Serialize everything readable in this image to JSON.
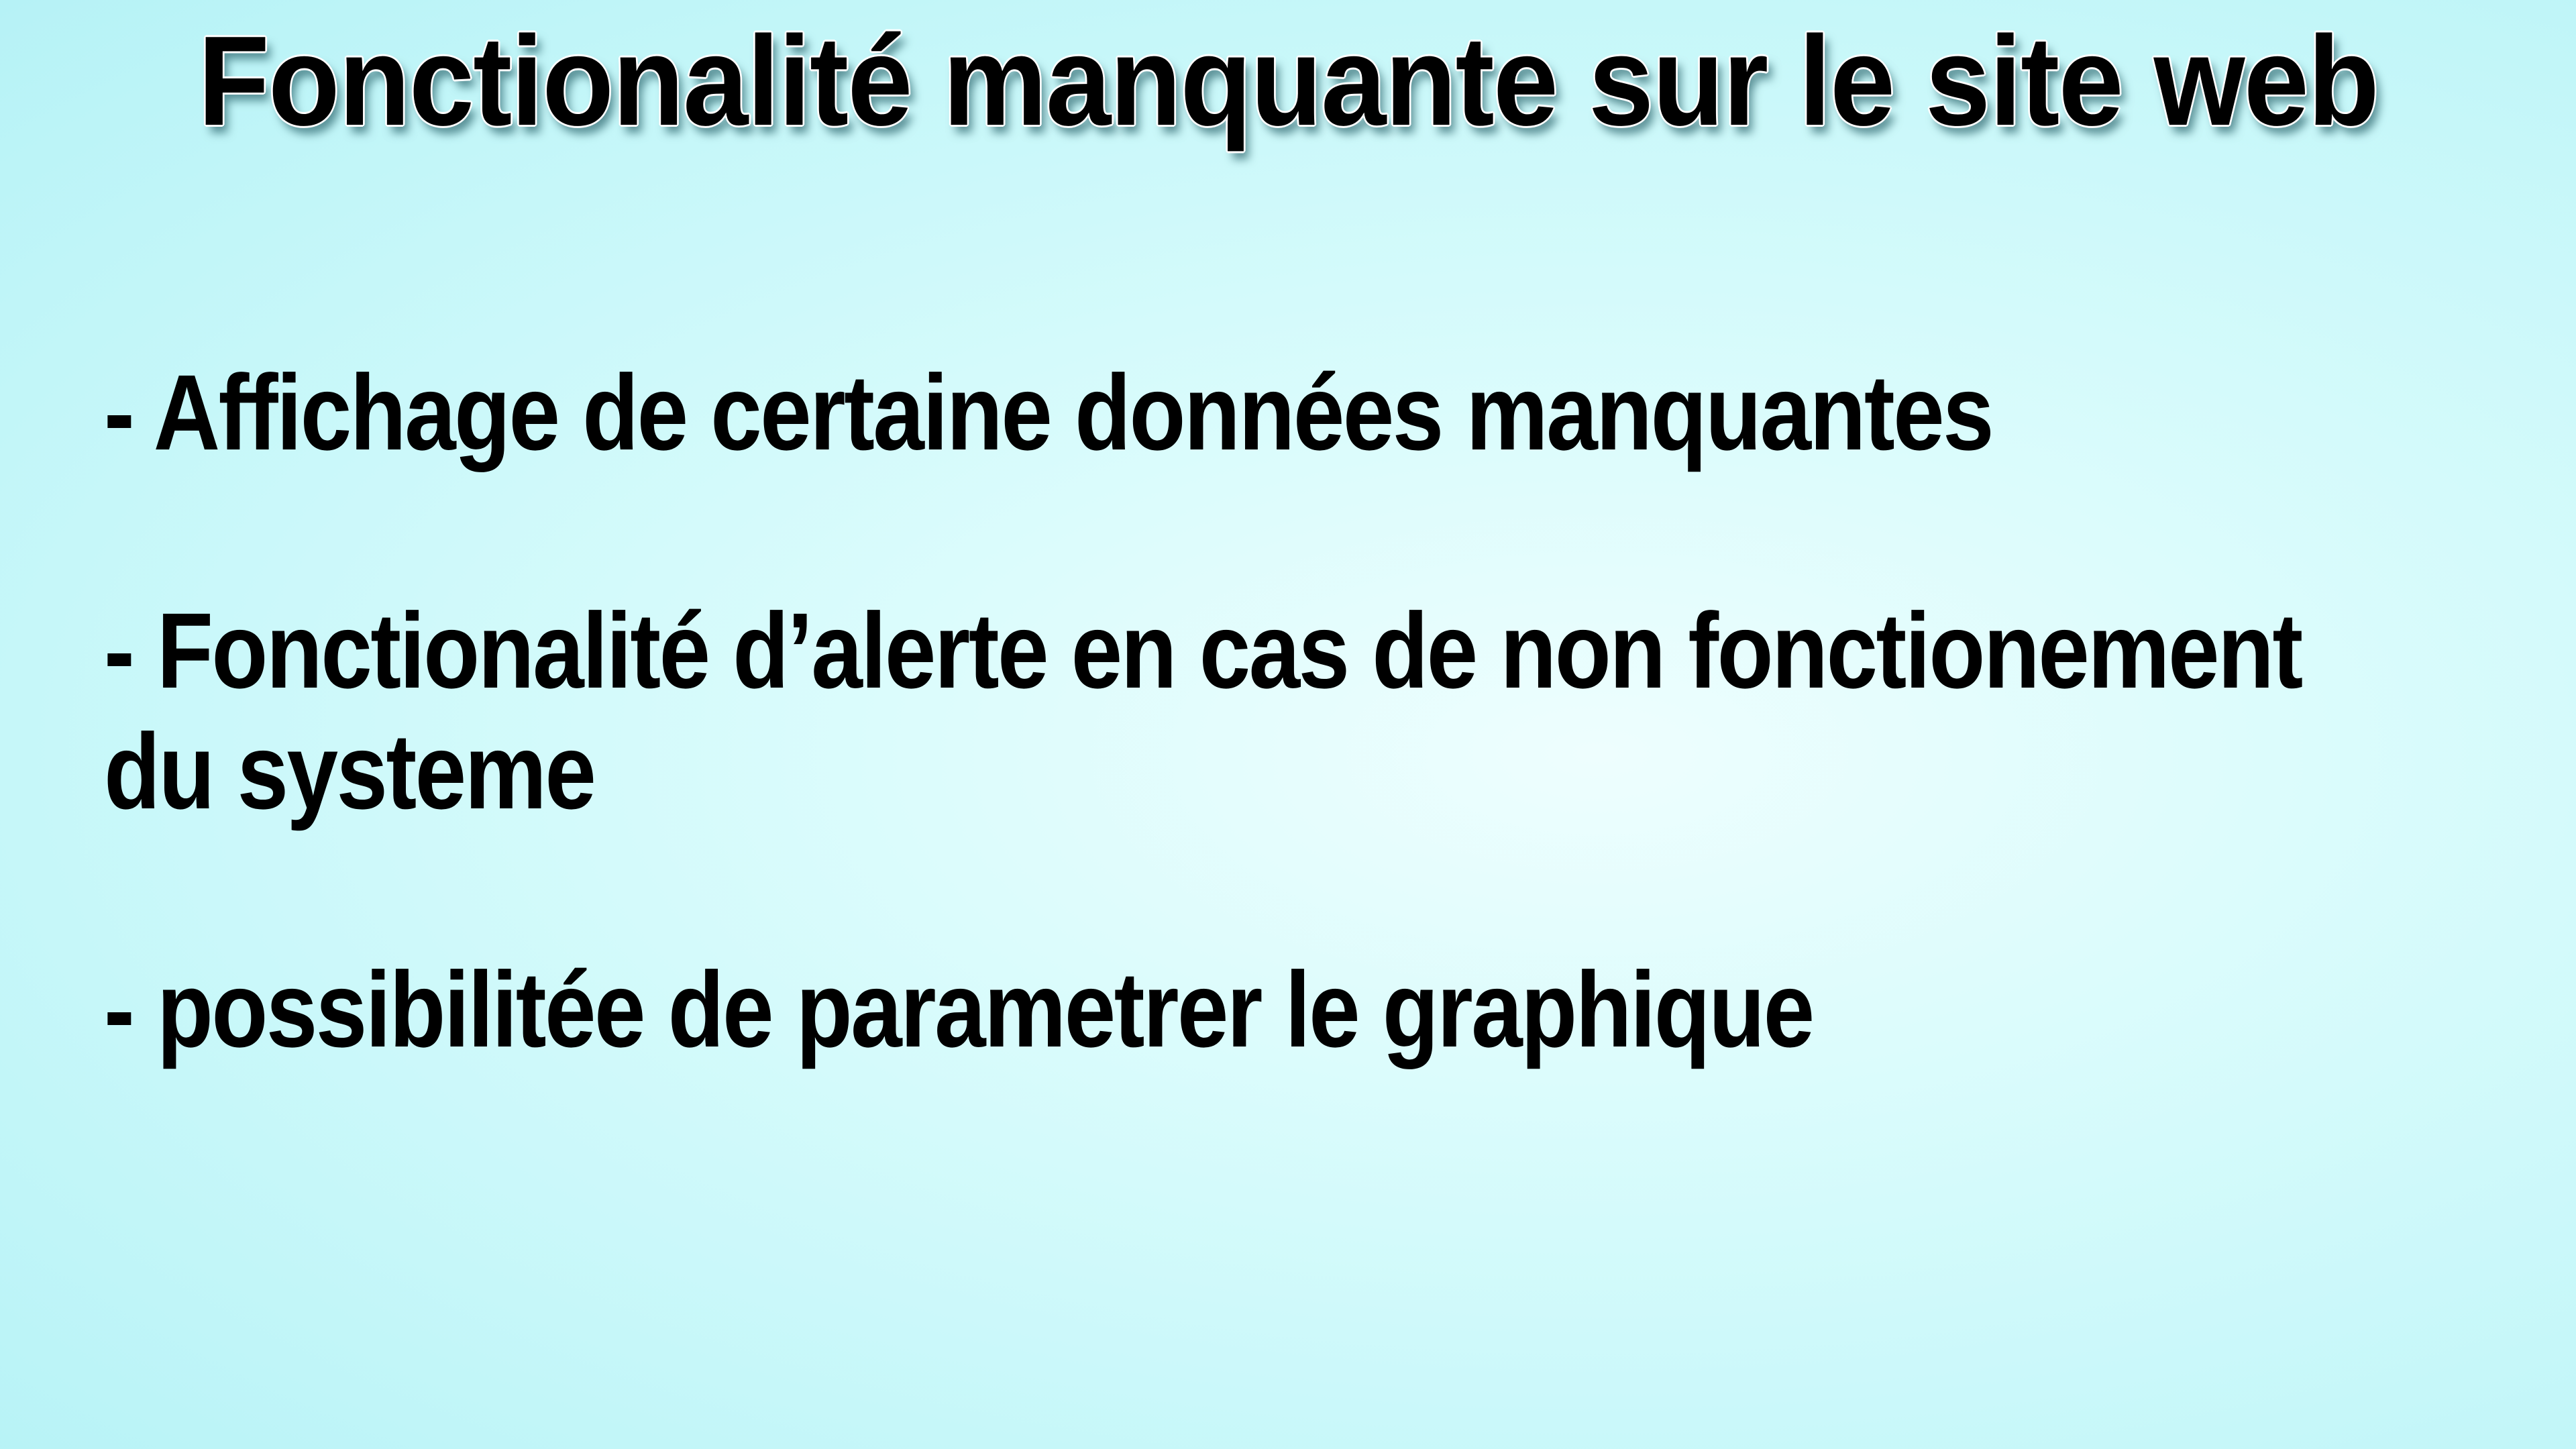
{
  "slide": {
    "title": "Fonctionalité manquante sur le site web",
    "bullets": [
      "- Affichage de certaine données manquantes",
      "- Fonctionalité d’alerte en cas de non fonctionement du systeme",
      "- possibilitée de parametrer le graphique"
    ]
  },
  "colors": {
    "background": "#d4fafb",
    "text": "#000000",
    "title_shadow": "#ffffff"
  }
}
